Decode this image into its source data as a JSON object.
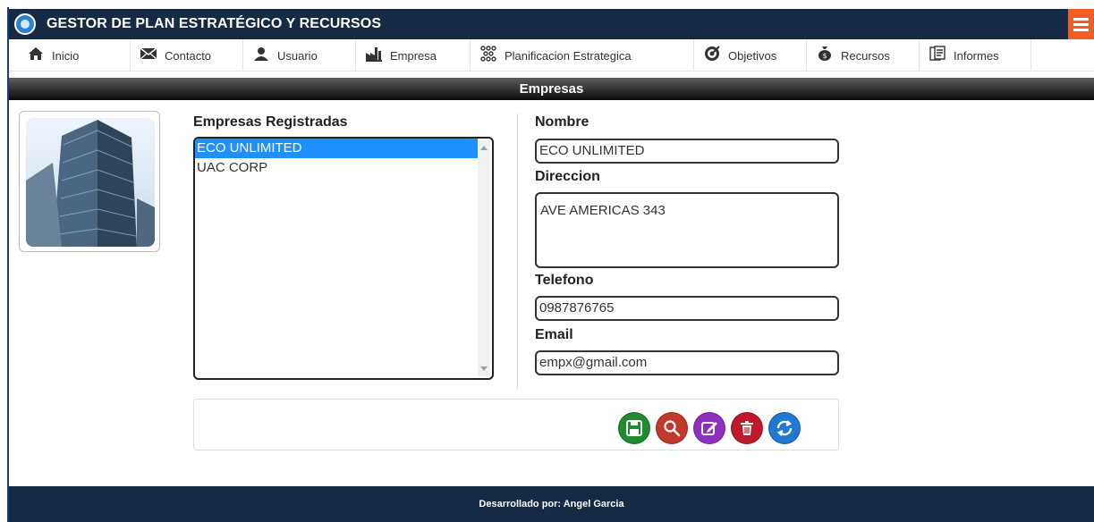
{
  "app": {
    "title": "GESTOR DE PLAN ESTRATÉGICO Y RECURSOS",
    "accent": "#172a45",
    "menu_button_color": "#f25b21"
  },
  "nav": {
    "items": [
      {
        "label": "Inicio",
        "icon": "home-icon"
      },
      {
        "label": "Contacto",
        "icon": "envelope-icon"
      },
      {
        "label": "Usuario",
        "icon": "user-icon"
      },
      {
        "label": "Empresa",
        "icon": "factory-icon"
      },
      {
        "label": "Planificacion Estrategica",
        "icon": "hierarchy-icon"
      },
      {
        "label": "Objetivos",
        "icon": "target-icon"
      },
      {
        "label": "Recursos",
        "icon": "money-bag-icon"
      },
      {
        "label": "Informes",
        "icon": "report-icon"
      }
    ]
  },
  "section": {
    "title": "Empresas"
  },
  "companies": {
    "label": "Empresas Registradas",
    "items": [
      "ECO UNLIMITED",
      "UAC CORP"
    ],
    "selected": "ECO UNLIMITED"
  },
  "form": {
    "nombre_label": "Nombre",
    "nombre_value": "ECO UNLIMITED",
    "direccion_label": "Direccion",
    "direccion_value": "AVE AMERICAS 343",
    "telefono_label": "Telefono",
    "telefono_value": "0987876765",
    "email_label": "Email",
    "email_value": "empx@gmail.com"
  },
  "actions": [
    {
      "name": "save",
      "icon": "save-icon",
      "color": "#1f8a2e"
    },
    {
      "name": "search",
      "icon": "search-icon",
      "color": "#c0392b"
    },
    {
      "name": "edit",
      "icon": "edit-icon",
      "color": "#8e2fc0"
    },
    {
      "name": "delete",
      "icon": "trash-icon",
      "color": "#c0182b"
    },
    {
      "name": "refresh",
      "icon": "refresh-icon",
      "color": "#1f78d1"
    }
  ],
  "footer": {
    "text": "Desarrollado por: Angel Garcia"
  }
}
